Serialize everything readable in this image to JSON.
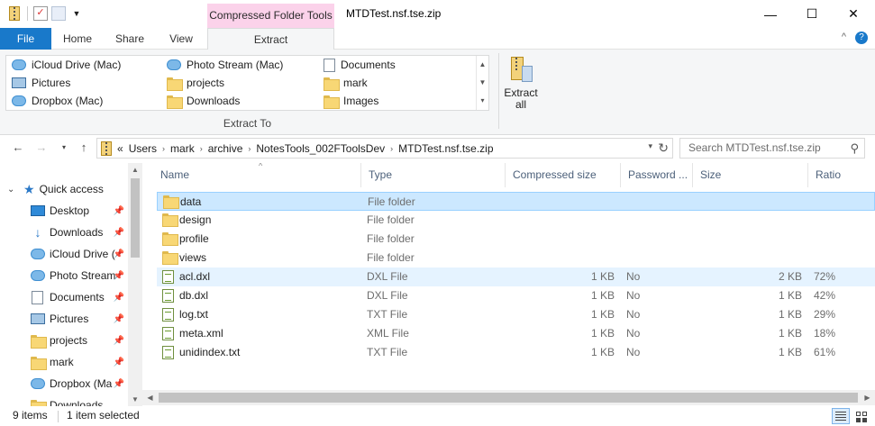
{
  "window": {
    "title": "MTDTest.nsf.tse.zip",
    "context_tab_header": "Compressed Folder Tools",
    "minimize": "—",
    "maximize": "☐",
    "close": "✕"
  },
  "tabs": {
    "file": "File",
    "home": "Home",
    "share": "Share",
    "view": "View",
    "extract": "Extract"
  },
  "ribbon": {
    "destinations": [
      {
        "label": "iCloud Drive (Mac)",
        "icon": "cloud-icon"
      },
      {
        "label": "Pictures",
        "icon": "pictures-icon"
      },
      {
        "label": "Dropbox (Mac)",
        "icon": "cloud-icon"
      },
      {
        "label": "Photo Stream (Mac)",
        "icon": "cloud-icon"
      },
      {
        "label": "projects",
        "icon": "folder-icon"
      },
      {
        "label": "Downloads",
        "icon": "folder-icon"
      },
      {
        "label": "Documents",
        "icon": "documents-icon"
      },
      {
        "label": "mark",
        "icon": "folder-icon"
      },
      {
        "label": "Images",
        "icon": "folder-icon"
      }
    ],
    "group_label": "Extract To",
    "extract_all_line1": "Extract",
    "extract_all_line2": "all"
  },
  "address": {
    "prefix": "«",
    "crumbs": [
      "Users",
      "mark",
      "archive",
      "NotesTools_002FToolsDev",
      "MTDTest.nsf.tse.zip"
    ],
    "search_placeholder": "Search MTDTest.nsf.tse.zip"
  },
  "navpane": {
    "quick_access": "Quick access",
    "items": [
      {
        "label": "Desktop",
        "icon": "desktop-icon",
        "pinned": true
      },
      {
        "label": "Downloads",
        "icon": "downloads-icon",
        "pinned": true
      },
      {
        "label": "iCloud Drive (",
        "icon": "cloud-icon",
        "pinned": true
      },
      {
        "label": "Photo Stream",
        "icon": "cloud-icon",
        "pinned": true
      },
      {
        "label": "Documents",
        "icon": "documents-icon",
        "pinned": true
      },
      {
        "label": "Pictures",
        "icon": "pictures-icon",
        "pinned": true
      },
      {
        "label": "projects",
        "icon": "folder-icon",
        "pinned": true
      },
      {
        "label": "mark",
        "icon": "folder-icon",
        "pinned": true
      },
      {
        "label": "Dropbox (Ma",
        "icon": "cloud-icon",
        "pinned": true
      },
      {
        "label": "Downloads",
        "icon": "folder-icon",
        "pinned": false
      }
    ]
  },
  "columns": {
    "name": "Name",
    "type": "Type",
    "compressed": "Compressed size",
    "password": "Password ...",
    "size": "Size",
    "ratio": "Ratio"
  },
  "files": [
    {
      "name": "data",
      "type": "File folder",
      "compressed": "",
      "password": "",
      "size": "",
      "ratio": "",
      "kind": "folder"
    },
    {
      "name": "design",
      "type": "File folder",
      "compressed": "",
      "password": "",
      "size": "",
      "ratio": "",
      "kind": "folder"
    },
    {
      "name": "profile",
      "type": "File folder",
      "compressed": "",
      "password": "",
      "size": "",
      "ratio": "",
      "kind": "folder"
    },
    {
      "name": "views",
      "type": "File folder",
      "compressed": "",
      "password": "",
      "size": "",
      "ratio": "",
      "kind": "folder"
    },
    {
      "name": "acl.dxl",
      "type": "DXL File",
      "compressed": "1 KB",
      "password": "No",
      "size": "2 KB",
      "ratio": "72%",
      "kind": "doc"
    },
    {
      "name": "db.dxl",
      "type": "DXL File",
      "compressed": "1 KB",
      "password": "No",
      "size": "1 KB",
      "ratio": "42%",
      "kind": "doc"
    },
    {
      "name": "log.txt",
      "type": "TXT File",
      "compressed": "1 KB",
      "password": "No",
      "size": "1 KB",
      "ratio": "29%",
      "kind": "doc"
    },
    {
      "name": "meta.xml",
      "type": "XML File",
      "compressed": "1 KB",
      "password": "No",
      "size": "1 KB",
      "ratio": "18%",
      "kind": "doc"
    },
    {
      "name": "unidindex.txt",
      "type": "TXT File",
      "compressed": "1 KB",
      "password": "No",
      "size": "1 KB",
      "ratio": "61%",
      "kind": "doc"
    }
  ],
  "status": {
    "items": "9 items",
    "selected": "1 item selected"
  },
  "colors": {
    "file_tab": "#1979ca",
    "context_tab": "#fbd2ea",
    "selection": "#cce8ff",
    "hover": "#e5f3ff"
  }
}
